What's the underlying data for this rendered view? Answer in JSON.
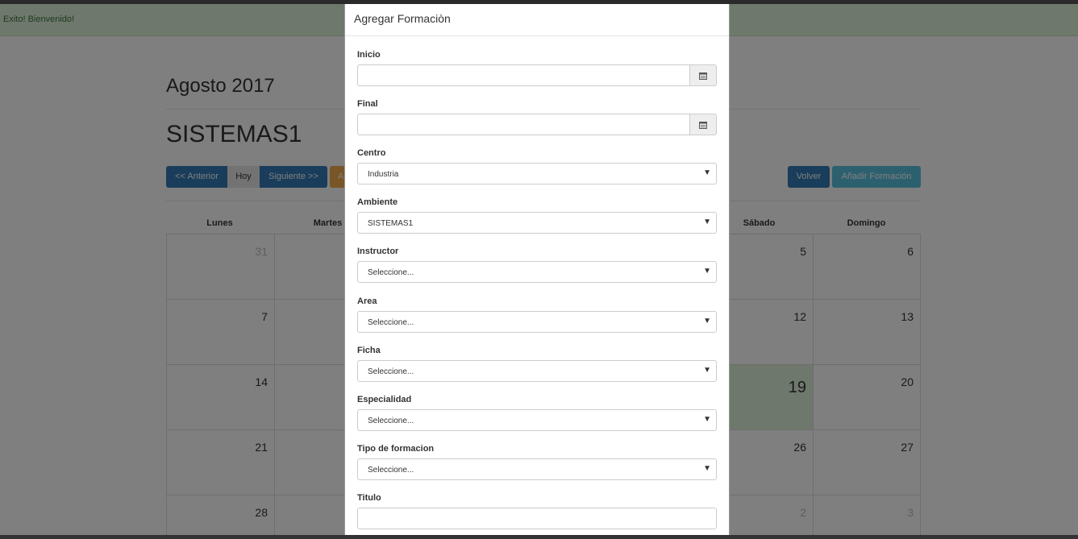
{
  "alert": {
    "text": "Exito! Bienvenido!"
  },
  "calendar": {
    "month_title": "Agosto 2017",
    "room_title": "SISTEMAS1",
    "buttons": {
      "prev": "<< Anterior",
      "today": "Hoy",
      "next": "Siguiente >>",
      "orange": "A",
      "back": "Volver",
      "add": "Añadir Formación"
    },
    "days_of_week": [
      "Lunes",
      "Martes",
      "Sábado",
      "Domingo"
    ],
    "rows": [
      [
        "31",
        "5",
        "6"
      ],
      [
        "7",
        "12",
        "13"
      ],
      [
        "14",
        "19",
        "20"
      ],
      [
        "21",
        "26",
        "27"
      ],
      [
        "28",
        "2",
        "3"
      ]
    ]
  },
  "modal": {
    "title": "Agregar Formaciòn",
    "inicio_label": "Inicio",
    "inicio_value": "",
    "final_label": "Final",
    "final_value": "",
    "centro_label": "Centro",
    "centro_value": "Industria",
    "ambiente_label": "Ambiente",
    "ambiente_value": "SISTEMAS1",
    "instructor_label": "Instructor",
    "instructor_value": "Seleccione...",
    "area_label": "Area",
    "area_value": "Seleccione...",
    "ficha_label": "Ficha",
    "ficha_value": "Seleccione...",
    "especialidad_label": "Especialidad",
    "especialidad_value": "Seleccione...",
    "tipo_label": "Tipo de formacion",
    "tipo_value": "Seleccione...",
    "titulo_label": "Titulo",
    "titulo_value": ""
  },
  "icons": {
    "calendar": "calendar-icon",
    "dropdown": "chevron-down-icon"
  }
}
